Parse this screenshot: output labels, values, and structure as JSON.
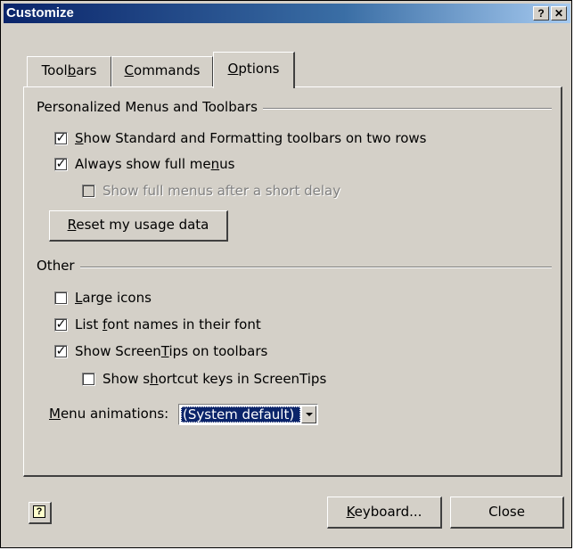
{
  "window": {
    "title": "Customize",
    "help_glyph": "?",
    "close_glyph": "✕"
  },
  "tabs": [
    {
      "pre": "Tool",
      "key": "b",
      "post": "ars",
      "active": false
    },
    {
      "pre": "",
      "key": "C",
      "post": "ommands",
      "active": false
    },
    {
      "pre": "",
      "key": "O",
      "post": "ptions",
      "active": true
    }
  ],
  "personalized": {
    "group_label": "Personalized Menus and Toolbars",
    "options": [
      {
        "pre": "",
        "key": "S",
        "post": "how Standard and Formatting toolbars on two rows",
        "checked": true,
        "enabled": true
      },
      {
        "pre": "Always show full me",
        "key": "n",
        "post": "us",
        "checked": true,
        "enabled": true
      },
      {
        "pre": "Show full menus after a short delay",
        "key": "",
        "post": "",
        "checked": false,
        "enabled": false
      }
    ],
    "reset_button": {
      "pre": "",
      "key": "R",
      "post": "eset my usage data"
    }
  },
  "other": {
    "group_label": "Other",
    "options": [
      {
        "pre": "",
        "key": "L",
        "post": "arge icons",
        "checked": false
      },
      {
        "pre": "List ",
        "key": "f",
        "post": "ont names in their font",
        "checked": true
      },
      {
        "pre": "Show Screen",
        "key": "T",
        "post": "ips on toolbars",
        "checked": true
      },
      {
        "pre": "Show s",
        "key": "h",
        "post": "ortcut keys in ScreenTips",
        "checked": false
      }
    ],
    "menu_animations": {
      "label_pre": "",
      "label_key": "M",
      "label_post": "enu animations:",
      "value": "(System default)"
    }
  },
  "footer": {
    "help_glyph": "?",
    "keyboard_button": {
      "pre": "",
      "key": "K",
      "post": "eyboard..."
    },
    "close_button": "Close"
  },
  "check_glyph": "✓"
}
